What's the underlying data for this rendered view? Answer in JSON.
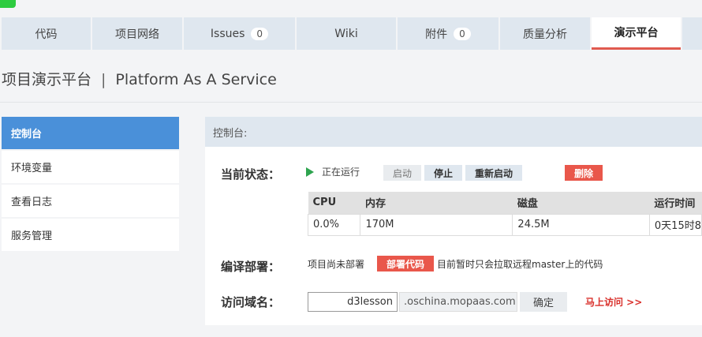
{
  "tabs": [
    {
      "label": "代码"
    },
    {
      "label": "项目网络"
    },
    {
      "label": "Issues",
      "badge": "0"
    },
    {
      "label": "Wiki"
    },
    {
      "label": "附件",
      "badge": "0"
    },
    {
      "label": "质量分析"
    },
    {
      "label": "演示平台",
      "active": true
    }
  ],
  "page": {
    "title": "项目演示平台",
    "separator": "|",
    "subtitle": "Platform As A Service"
  },
  "sidebar": {
    "items": [
      {
        "label": "控制台",
        "active": true
      },
      {
        "label": "环境变量"
      },
      {
        "label": "查看日志"
      },
      {
        "label": "服务管理"
      }
    ]
  },
  "panel": {
    "header": "控制台:",
    "status": {
      "label": "当前状态：",
      "running_text": "正在运行",
      "start_label": "启动",
      "stop_label": "停止",
      "restart_label": "重新启动",
      "delete_label": "删除"
    },
    "stats": {
      "headers": [
        "CPU",
        "内存",
        "磁盘",
        "运行时间"
      ],
      "values": [
        "0.0%",
        "170M",
        "24.5M",
        "0天15时8"
      ]
    },
    "deploy": {
      "label": "编译部署：",
      "prefix_text": "项目尚未部署",
      "button_label": "部署代码",
      "note_text": "目前暂时只会拉取远程master上的代码"
    },
    "domain": {
      "label": "访问域名：",
      "value": "d3lesson",
      "suffix": ".oschina.mopaas.com",
      "confirm_label": "确定",
      "visit_label": "马上访问 >>"
    }
  },
  "colors": {
    "accent_red": "#e9574b",
    "active_blue": "#4a90d9",
    "tab_bg": "#dfe7ef",
    "running_green": "#2ea44f"
  }
}
